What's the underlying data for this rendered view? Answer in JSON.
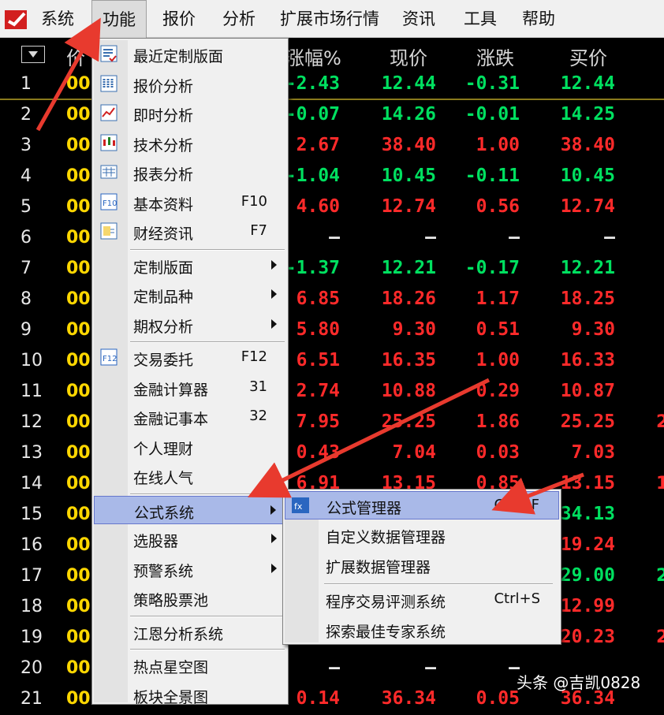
{
  "menubar": {
    "items": [
      "系统",
      "功能",
      "报价",
      "分析",
      "扩展市场行情",
      "资讯",
      "工具",
      "帮助"
    ],
    "active_index": 1
  },
  "table": {
    "headers": {
      "price_partial": "价",
      "change_pct": "涨幅%",
      "price": "现价",
      "diff": "涨跌",
      "buy": "买价"
    },
    "rows": [
      {
        "num": "1",
        "code": "00",
        "chg": "-2.43",
        "price": "12.44",
        "diff": "-0.31",
        "buy": "12.44",
        "color": "green"
      },
      {
        "num": "2",
        "code": "00",
        "chg": "-0.07",
        "price": "14.26",
        "diff": "-0.01",
        "buy": "14.25",
        "color": "green"
      },
      {
        "num": "3",
        "code": "00",
        "chg": "2.67",
        "price": "38.40",
        "diff": "1.00",
        "buy": "38.40",
        "color": "red"
      },
      {
        "num": "4",
        "code": "00",
        "chg": "-1.04",
        "price": "10.45",
        "diff": "-0.11",
        "buy": "10.45",
        "color": "green"
      },
      {
        "num": "5",
        "code": "00",
        "chg": "4.60",
        "price": "12.74",
        "diff": "0.56",
        "buy": "12.74",
        "color": "red"
      },
      {
        "num": "6",
        "code": "00",
        "chg": "—",
        "price": "—",
        "diff": "—",
        "buy": "—",
        "color": "white"
      },
      {
        "num": "7",
        "code": "00",
        "chg": "-1.37",
        "price": "12.21",
        "diff": "-0.17",
        "buy": "12.21",
        "color": "green"
      },
      {
        "num": "8",
        "code": "00",
        "chg": "6.85",
        "price": "18.26",
        "diff": "1.17",
        "buy": "18.25",
        "color": "red"
      },
      {
        "num": "9",
        "code": "00",
        "chg": "5.80",
        "price": "9.30",
        "diff": "0.51",
        "buy": "9.30",
        "color": "red"
      },
      {
        "num": "10",
        "code": "00",
        "chg": "6.51",
        "price": "16.35",
        "diff": "1.00",
        "buy": "16.33",
        "color": "red"
      },
      {
        "num": "11",
        "code": "00",
        "chg": "2.74",
        "price": "10.88",
        "diff": "0.29",
        "buy": "10.87",
        "color": "red"
      },
      {
        "num": "12",
        "code": "00",
        "chg": "7.95",
        "price": "25.25",
        "diff": "1.86",
        "buy": "25.25",
        "color": "red"
      },
      {
        "num": "13",
        "code": "00",
        "chg": "0.43",
        "price": "7.04",
        "diff": "0.03",
        "buy": "7.03",
        "color": "red"
      },
      {
        "num": "14",
        "code": "00",
        "chg": "6.91",
        "price": "13.15",
        "diff": "0.85",
        "buy": "13.15",
        "color": "red"
      },
      {
        "num": "15",
        "code": "00",
        "chg": "",
        "price": "",
        "diff": "",
        "buy": "34.13",
        "color": "green"
      },
      {
        "num": "16",
        "code": "00",
        "chg": "",
        "price": "",
        "diff": "",
        "buy": "19.24",
        "color": "red"
      },
      {
        "num": "17",
        "code": "00",
        "chg": "",
        "price": "",
        "diff": "",
        "buy": "29.00",
        "color": "green"
      },
      {
        "num": "18",
        "code": "00",
        "chg": "",
        "price": "",
        "diff": "",
        "buy": "12.99",
        "color": "red"
      },
      {
        "num": "19",
        "code": "00",
        "chg": "",
        "price": "",
        "diff": "",
        "buy": "20.23",
        "color": "red"
      },
      {
        "num": "20",
        "code": "00",
        "chg": "—",
        "price": "—",
        "diff": "—",
        "buy": "",
        "color": "white"
      },
      {
        "num": "21",
        "code": "00",
        "chg": "0.14",
        "price": "36.34",
        "diff": "0.05",
        "buy": "36.34",
        "color": "red"
      }
    ],
    "edge_values": [
      {
        "row": 12,
        "text": "2",
        "color": "red"
      },
      {
        "row": 14,
        "text": "1",
        "color": "red"
      },
      {
        "row": 17,
        "text": "2",
        "color": "green"
      },
      {
        "row": 19,
        "text": "2",
        "color": "red"
      }
    ]
  },
  "function_menu": {
    "items": [
      {
        "label": "最近定制版面",
        "shortcut": "",
        "icon": "recent-layout-icon",
        "submenu": false
      },
      {
        "label": "报价分析",
        "shortcut": "",
        "icon": "quote-analysis-icon",
        "submenu": false
      },
      {
        "label": "即时分析",
        "shortcut": "",
        "icon": "realtime-chart-icon",
        "submenu": false
      },
      {
        "label": "技术分析",
        "shortcut": "",
        "icon": "candlestick-icon",
        "submenu": false
      },
      {
        "label": "报表分析",
        "shortcut": "",
        "icon": "report-icon",
        "submenu": false
      },
      {
        "label": "基本资料",
        "shortcut": "F10",
        "icon": "f10-icon",
        "submenu": false
      },
      {
        "label": "财经资讯",
        "shortcut": "F7",
        "icon": "news-icon",
        "submenu": false
      },
      {
        "separator": true
      },
      {
        "label": "定制版面",
        "shortcut": "",
        "icon": "",
        "submenu": true
      },
      {
        "label": "定制品种",
        "shortcut": "",
        "icon": "",
        "submenu": true
      },
      {
        "label": "期权分析",
        "shortcut": "",
        "icon": "",
        "submenu": true
      },
      {
        "separator": true
      },
      {
        "label": "交易委托",
        "shortcut": "F12",
        "icon": "f12-icon",
        "submenu": false
      },
      {
        "label": "金融计算器",
        "shortcut": "31",
        "icon": "",
        "submenu": false
      },
      {
        "label": "金融记事本",
        "shortcut": "32",
        "icon": "",
        "submenu": false
      },
      {
        "label": "个人理财",
        "shortcut": "",
        "icon": "",
        "submenu": false
      },
      {
        "label": "在线人气",
        "shortcut": "",
        "icon": "",
        "submenu": false
      },
      {
        "separator": true
      },
      {
        "label": "公式系统",
        "shortcut": "",
        "icon": "",
        "submenu": true,
        "highlighted": true
      },
      {
        "label": "选股器",
        "shortcut": "",
        "icon": "",
        "submenu": true
      },
      {
        "label": "预警系统",
        "shortcut": "",
        "icon": "",
        "submenu": true
      },
      {
        "label": "策略股票池",
        "shortcut": "",
        "icon": "",
        "submenu": false
      },
      {
        "separator": true
      },
      {
        "label": "江恩分析系统",
        "shortcut": "",
        "icon": "",
        "submenu": false
      },
      {
        "separator": true
      },
      {
        "label": "热点星空图",
        "shortcut": "",
        "icon": "",
        "submenu": false
      },
      {
        "label": "板块全景图",
        "shortcut": "",
        "icon": "",
        "submenu": false
      }
    ]
  },
  "formula_submenu": {
    "items": [
      {
        "label": "公式管理器",
        "shortcut": "Ctrl+F",
        "icon": "formula-manager-icon",
        "highlighted": true
      },
      {
        "label": "自定义数据管理器",
        "shortcut": ""
      },
      {
        "label": "扩展数据管理器",
        "shortcut": ""
      },
      {
        "separator": true
      },
      {
        "label": "程序交易评测系统",
        "shortcut": "Ctrl+S"
      },
      {
        "label": "探索最佳专家系统",
        "shortcut": ""
      }
    ]
  },
  "colors": {
    "red": "#ff2a2a",
    "green": "#00e060",
    "white": "#e8e8e8",
    "yellow": "#ffd700",
    "arrow": "#e83a2e",
    "highlight": "#a9b9e8"
  },
  "watermark": "头条 @吉凯0828"
}
